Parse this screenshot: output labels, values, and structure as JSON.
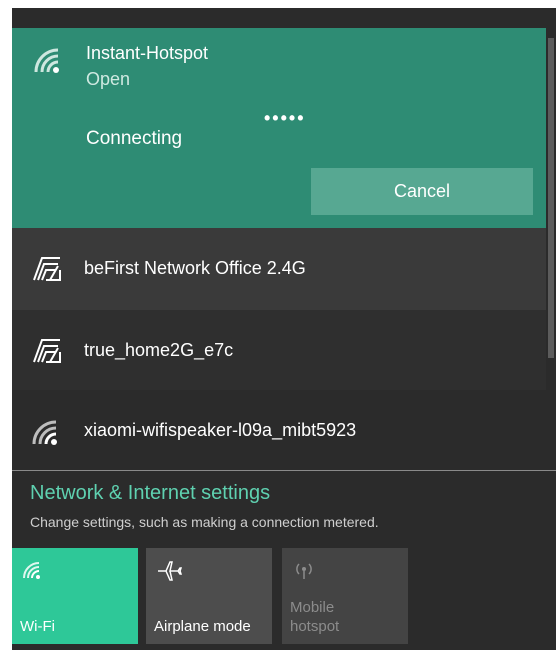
{
  "expanded_network": {
    "name": "Instant-Hotspot",
    "security": "Open",
    "progress_dots": "•••••",
    "status": "Connecting",
    "cancel_label": "Cancel"
  },
  "networks": [
    {
      "name": "beFirst Network Office 2.4G",
      "icon": "wifi-secured-icon"
    },
    {
      "name": "true_home2G_e7c",
      "icon": "wifi-secured-icon"
    },
    {
      "name": "xiaomi-wifispeaker-l09a_mibt5923",
      "icon": "wifi-icon"
    }
  ],
  "settings": {
    "link": "Network & Internet settings",
    "description": "Change settings, such as making a connection metered."
  },
  "quick_actions": [
    {
      "label": "Wi-Fi",
      "icon": "wifi-icon",
      "active": true
    },
    {
      "label": "Airplane mode",
      "icon": "airplane-icon",
      "active": false
    },
    {
      "label": "Mobile hotspot",
      "icon": "mobile-hotspot-icon",
      "active": false
    }
  ],
  "colors": {
    "accent": "#2e8c74",
    "tile_active": "#2ec898",
    "link": "#5fd1b0",
    "background": "#2b2b2b"
  }
}
